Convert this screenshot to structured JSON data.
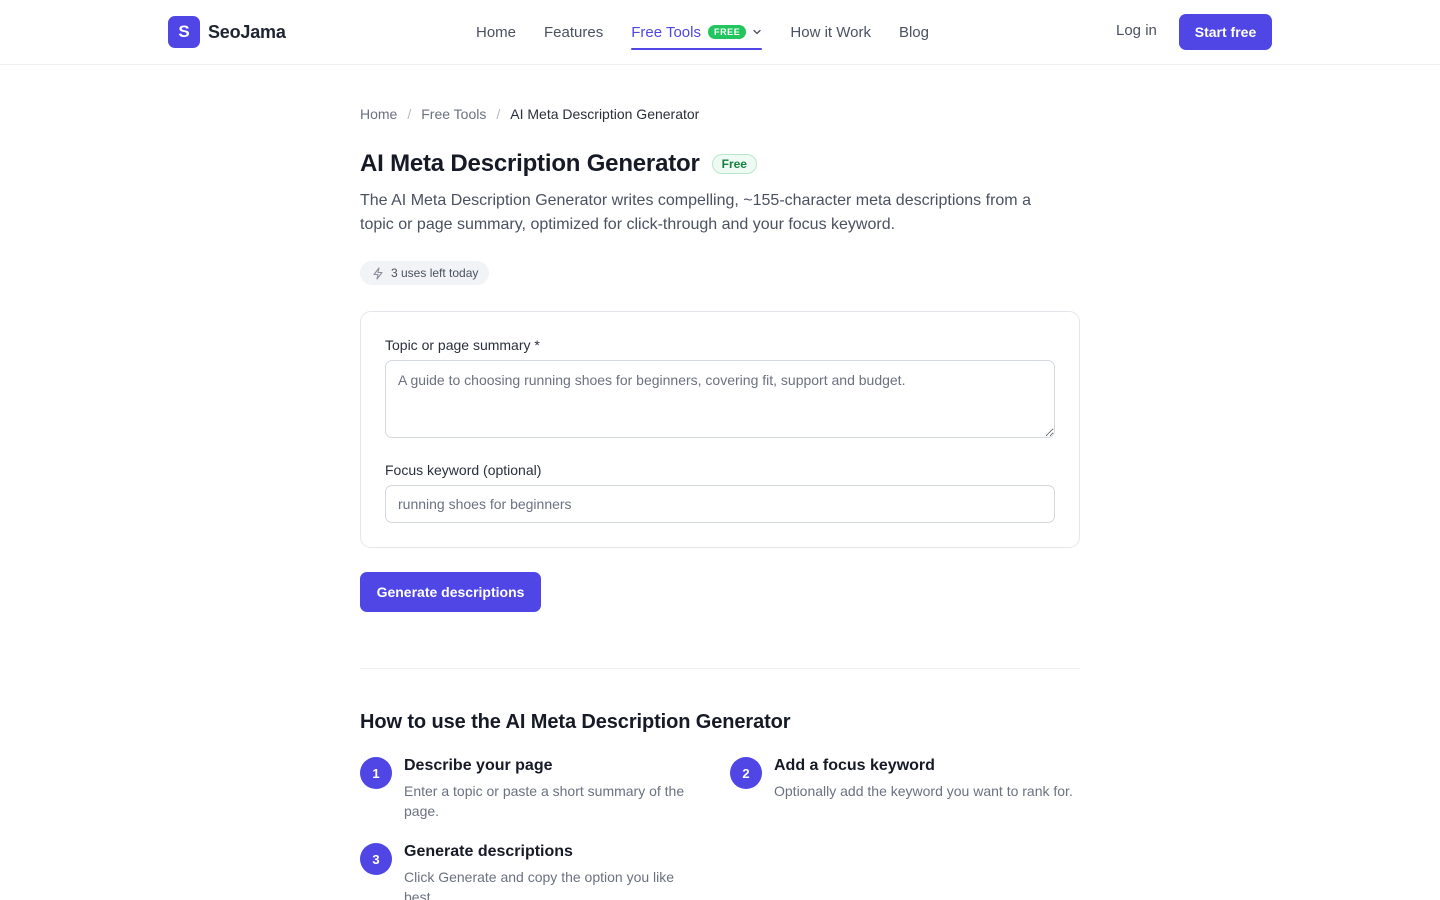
{
  "brand": {
    "logo_letter": "S",
    "name": "SeoJama",
    "accent": "#4f46e5"
  },
  "nav": {
    "items": [
      {
        "label": "Home"
      },
      {
        "label": "Features"
      },
      {
        "label": "Free Tools",
        "badge": "FREE",
        "active": true
      },
      {
        "label": "How it Work"
      },
      {
        "label": "Blog"
      }
    ],
    "login_label": "Log in",
    "start_label": "Start free"
  },
  "breadcrumb": {
    "items": [
      "Home",
      "Free Tools",
      "AI Meta Description Generator"
    ],
    "separator": "/"
  },
  "page": {
    "title": "AI Meta Description Generator",
    "badge": "Free",
    "description": "The AI Meta Description Generator writes compelling, ~155-character meta descriptions from a topic or page summary, optimized for click-through and your focus keyword.",
    "uses_left": "3 uses left today"
  },
  "form": {
    "topic_label": "Topic or page summary *",
    "topic_placeholder": "A guide to choosing running shoes for beginners, covering fit, support and budget.",
    "keyword_label": "Focus keyword (optional)",
    "keyword_placeholder": "running shoes for beginners",
    "submit_label": "Generate descriptions"
  },
  "howto": {
    "title": "How to use the AI Meta Description Generator",
    "steps": [
      {
        "num": "1",
        "title": "Describe your page",
        "text": "Enter a topic or paste a short summary of the page."
      },
      {
        "num": "2",
        "title": "Add a focus keyword",
        "text": "Optionally add the keyword you want to rank for."
      },
      {
        "num": "3",
        "title": "Generate descriptions",
        "text": "Click Generate and copy the option you like best."
      }
    ]
  }
}
